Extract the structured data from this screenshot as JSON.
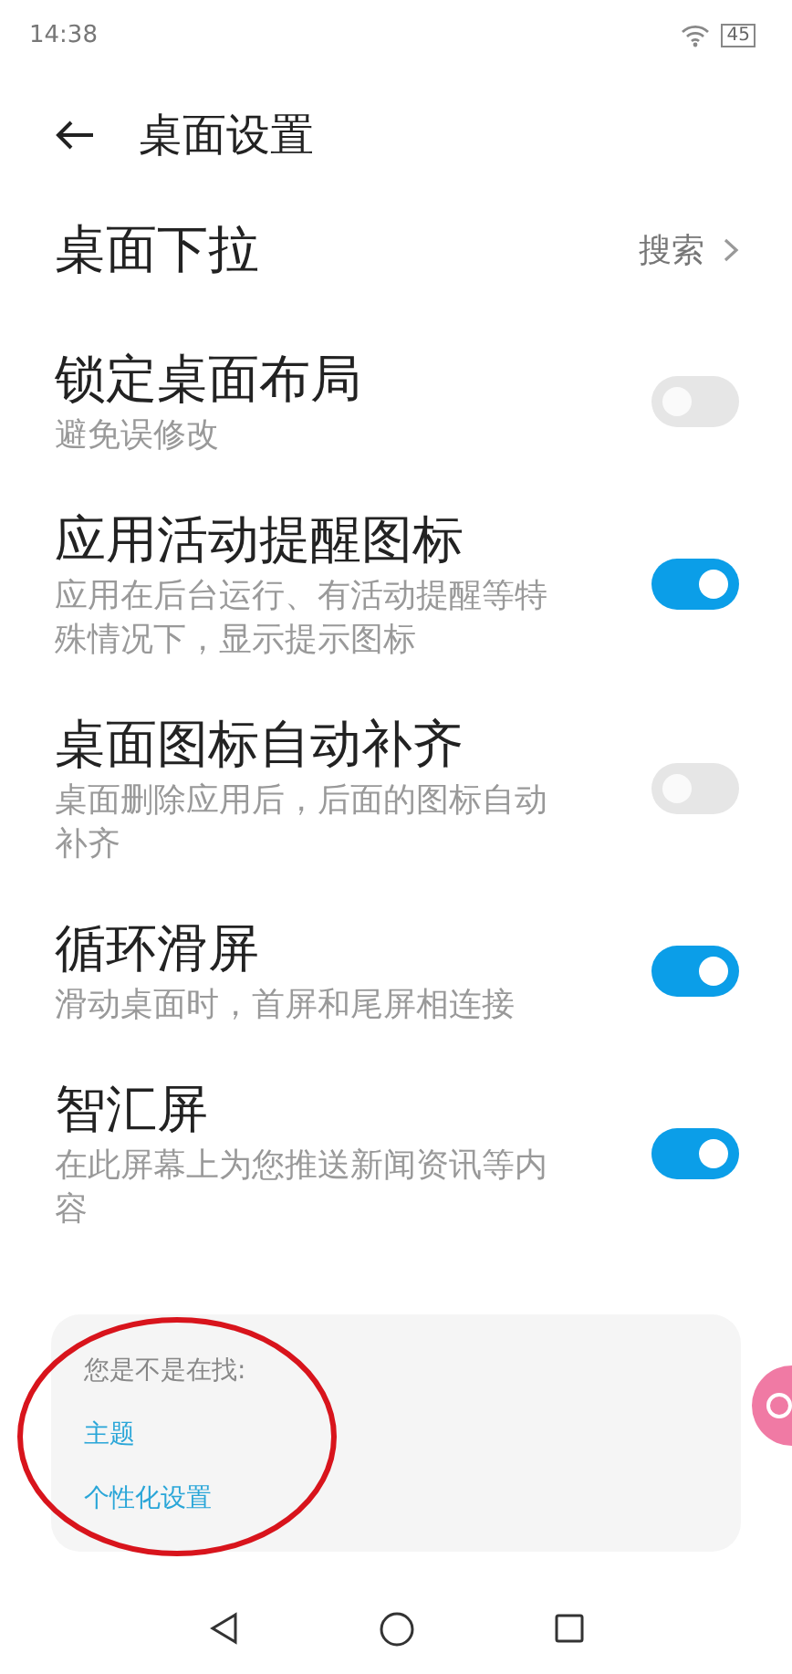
{
  "status_bar": {
    "time": "14:38",
    "battery": "45"
  },
  "header": {
    "title": "桌面设置"
  },
  "settings": [
    {
      "kind": "link",
      "title": "桌面下拉",
      "value": "搜索"
    },
    {
      "kind": "toggle",
      "title": "锁定桌面布局",
      "description": "避免误修改",
      "on": false
    },
    {
      "kind": "toggle",
      "title": "应用活动提醒图标",
      "description": "应用在后台运行、有活动提醒等特殊情况下，显示提示图标",
      "on": true
    },
    {
      "kind": "toggle",
      "title": "桌面图标自动补齐",
      "description": "桌面删除应用后，后面的图标自动补齐",
      "on": false
    },
    {
      "kind": "toggle",
      "title": "循环滑屏",
      "description": "滑动桌面时，首屏和尾屏相连接",
      "on": true
    },
    {
      "kind": "toggle",
      "title": "智汇屏",
      "description": "在此屏幕上为您推送新闻资讯等内容",
      "on": true
    }
  ],
  "suggestions": {
    "heading": "您是不是在找:",
    "links": [
      "主题",
      "个性化设置"
    ]
  }
}
